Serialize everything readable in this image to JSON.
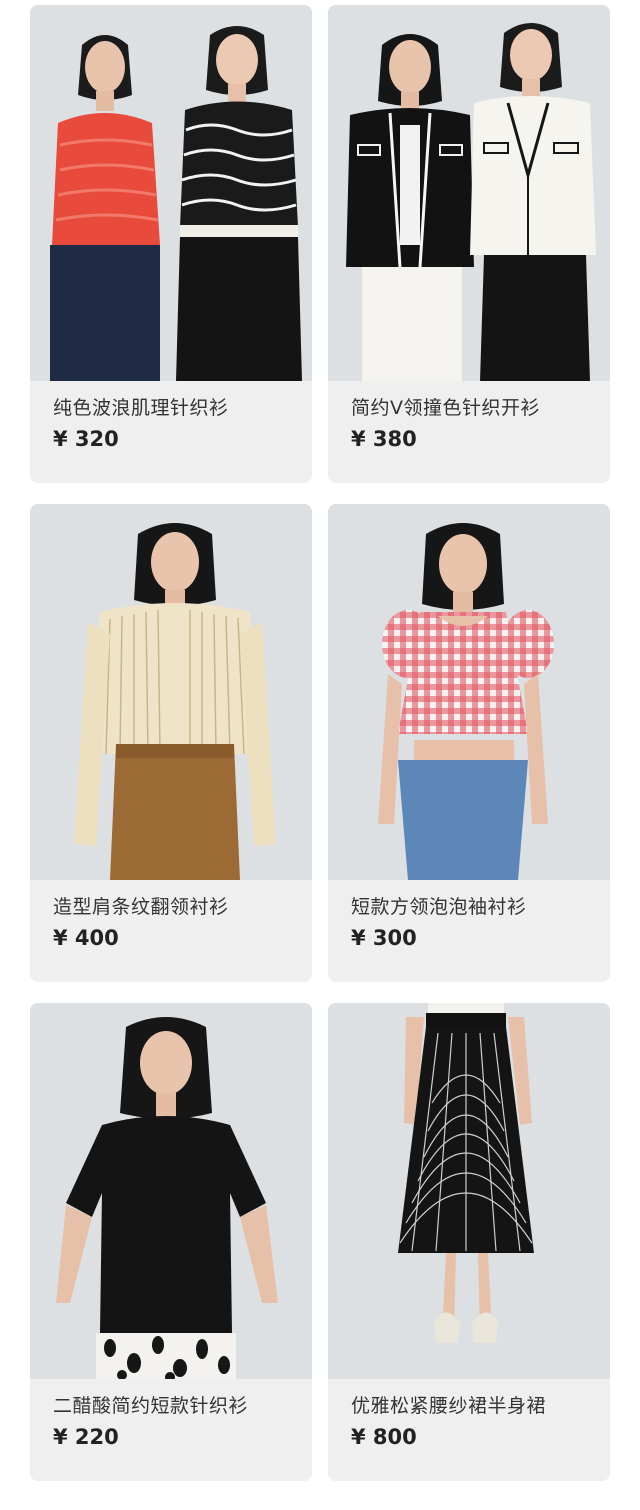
{
  "products": [
    {
      "name": "纯色波浪肌理针织衫",
      "price": "¥ 320",
      "image": "two models in red and black-white wavy knit tops"
    },
    {
      "name": "简约V领撞色针织开衫",
      "price": "¥ 380",
      "image": "two models in black and white contrast-trim cardigans"
    },
    {
      "name": "造型肩条纹翻领衬衫",
      "price": "¥ 400",
      "image": "model in striped shirt with brown skirt"
    },
    {
      "name": "短款方领泡泡袖衬衫",
      "price": "¥ 300",
      "image": "model in red gingham puff-sleeve crop top and jeans"
    },
    {
      "name": "二醋酸简约短款针织衫",
      "price": "¥ 220",
      "image": "model in black short-sleeve knit top"
    },
    {
      "name": "优雅松紧腰纱裙半身裙",
      "price": "¥ 800",
      "image": "black pleated tulle midi skirt"
    }
  ],
  "colors": {
    "card_bg": "#efefef",
    "photo_bg": "#dfe2e5",
    "text": "#333333"
  }
}
